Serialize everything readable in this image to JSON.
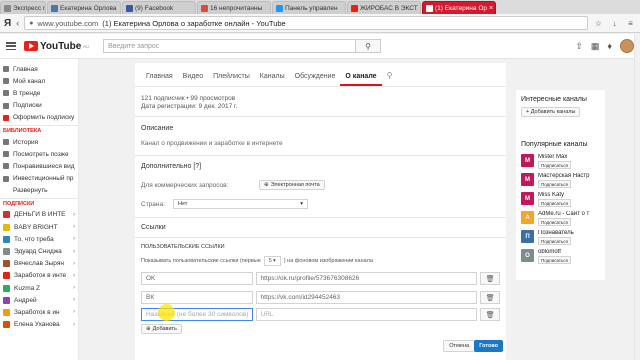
{
  "browser": {
    "tabs": [
      {
        "label": "Экспресс панель",
        "color": "#888888"
      },
      {
        "label": "Екатерина Орлова",
        "color": "#4a76a8"
      },
      {
        "label": "(9) Facebook",
        "color": "#3b5998"
      },
      {
        "label": "16 непрочитанны",
        "color": "#dd4b39"
      },
      {
        "label": "Панель управлен",
        "color": "#2196f3"
      },
      {
        "label": "ЖИРОБАС В ЭКСТ",
        "color": "#e62117"
      },
      {
        "label": "(1) Екатерина Ор",
        "color": "#ffffff"
      }
    ],
    "ya": "Я",
    "url_domain": "www.youtube.com",
    "url_title": "(1) Екатерина Орлова о заработке онлайн - YouTube"
  },
  "header": {
    "logo_text": "YouTube",
    "logo_region": "RU",
    "search_placeholder": "Введите запрос"
  },
  "sidebar": {
    "main": [
      {
        "label": "Главная",
        "icon": "home-icon"
      },
      {
        "label": "Мой канал",
        "icon": "person-icon"
      },
      {
        "label": "В тренде",
        "icon": "flame-icon"
      },
      {
        "label": "Подписки",
        "icon": "subscriptions-icon"
      },
      {
        "label": "Оформить подписку",
        "icon": "youtube-red-icon"
      }
    ],
    "library_title": "БИБЛИОТЕКА",
    "library": [
      {
        "label": "История",
        "icon": "history-icon"
      },
      {
        "label": "Посмотреть позже",
        "icon": "clock-icon"
      },
      {
        "label": "Понравившиеся вид",
        "icon": "thumb-up-icon"
      },
      {
        "label": "Инвестиционный пр",
        "icon": "playlist-icon"
      },
      {
        "label": "Развернуть",
        "icon": ""
      }
    ],
    "subs_title": "ПОДПИСКИ",
    "subs": [
      {
        "label": "ДЕНЬГИ В ИНТЕ",
        "color": "#c0392b"
      },
      {
        "label": "BABY BRIGHT",
        "color": "#e6b800"
      },
      {
        "label": "То, что треба",
        "color": "#2e86c1"
      },
      {
        "label": "Эдуард Сниджа",
        "color": "#7f8c8d"
      },
      {
        "label": "Вячеслав Зырян",
        "color": "#a0522d"
      },
      {
        "label": "Заработок в инте",
        "color": "#e62117"
      },
      {
        "label": "Kuzma Z",
        "color": "#27ae60"
      },
      {
        "label": "Андрей",
        "color": "#8e44ad"
      },
      {
        "label": "Заработок в ин",
        "color": "#f39c12"
      },
      {
        "label": "Елена Уханова",
        "color": "#d35400"
      }
    ]
  },
  "main": {
    "tabs": [
      "Главная",
      "Видео",
      "Плейлисты",
      "Каналы",
      "Обсуждение",
      "О канале"
    ],
    "active_tab": "О канале",
    "subs_line": "121 подписчик • 99 просмотров",
    "reg_line": "Дата регистрации: 9 дек. 2017 г.",
    "desc_title": "Описание",
    "desc_text": "Канал о продвижении и заработке в интернете",
    "extra_title": "Дополнительно [?]",
    "biz_label": "Для коммерческих запросов:",
    "email_btn": "Электронная почта",
    "country_label": "Страна:",
    "country_value": "Нет",
    "links_title": "Ссылки",
    "custom_links_title": "ПОЛЬЗОВАТЕЛЬСКИЕ ССЫЛКИ",
    "show_label_pre": "Показывать пользовательские ссылки (первые",
    "show_count": "5",
    "show_label_post": ") на фоновом изображении канала",
    "links": [
      {
        "name": "OK",
        "url": "https://ok.ru/profile/573676308626"
      },
      {
        "name": "ВК",
        "url": "https://vk.com/id294452463"
      }
    ],
    "new_link_name_placeholder": "Название (не более 30 символов)",
    "new_link_url_placeholder": "URL",
    "add_btn": "Добавить",
    "cancel_btn": "Отмена",
    "done_btn": "Готово"
  },
  "right": {
    "interesting_title": "Интересные каналы",
    "add_channel_btn": "+ Добавить каналы",
    "popular_title": "Популярные каналы",
    "channels": [
      {
        "name": "Mister Max",
        "color": "#c2185b",
        "letter": "M"
      },
      {
        "name": "Мастерская Настр",
        "color": "#c2185b",
        "letter": "M"
      },
      {
        "name": "Miss Katy",
        "color": "#c2185b",
        "letter": "M"
      },
      {
        "name": "AdMe.ru - Сайт о т",
        "color": "#f5a623",
        "letter": "A"
      },
      {
        "name": "Познаватель",
        "color": "#3a6ea5",
        "letter": "П"
      },
      {
        "name": "oblomoff",
        "color": "#7f8c8d",
        "letter": "O"
      }
    ],
    "subscribe_label": "Подписаться"
  }
}
